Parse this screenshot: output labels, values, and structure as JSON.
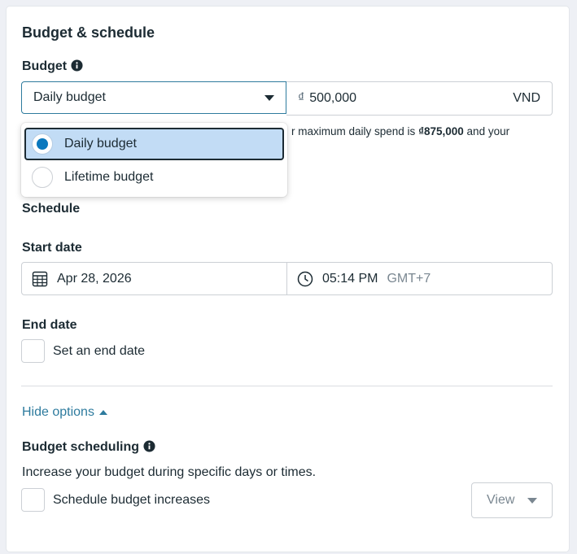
{
  "section_title": "Budget & schedule",
  "budget": {
    "label": "Budget",
    "type_selected": "Daily budget",
    "currency_symbol": "₫",
    "amount": "500,000",
    "currency_code": "VND",
    "hint_prefix": "r maximum daily spend is ",
    "hint_value": "₫875,000",
    "hint_suffix": " and your",
    "options": [
      {
        "label": "Daily budget",
        "selected": true
      },
      {
        "label": "Lifetime budget",
        "selected": false
      }
    ]
  },
  "schedule": {
    "label": "Schedule",
    "start_date_label": "Start date",
    "start_date": "Apr 28, 2026",
    "start_time": "05:14 PM",
    "timezone": "GMT+7",
    "end_date_label": "End date",
    "end_date_checkbox_label": "Set an end date"
  },
  "options_toggle": "Hide options",
  "budget_scheduling": {
    "label": "Budget scheduling",
    "description": "Increase your budget during specific days or times.",
    "checkbox_label": "Schedule budget increases",
    "view_label": "View"
  },
  "colors": {
    "accent": "#0a78be",
    "link": "#2e7b9e",
    "selected_bg": "#c2dcf5"
  }
}
